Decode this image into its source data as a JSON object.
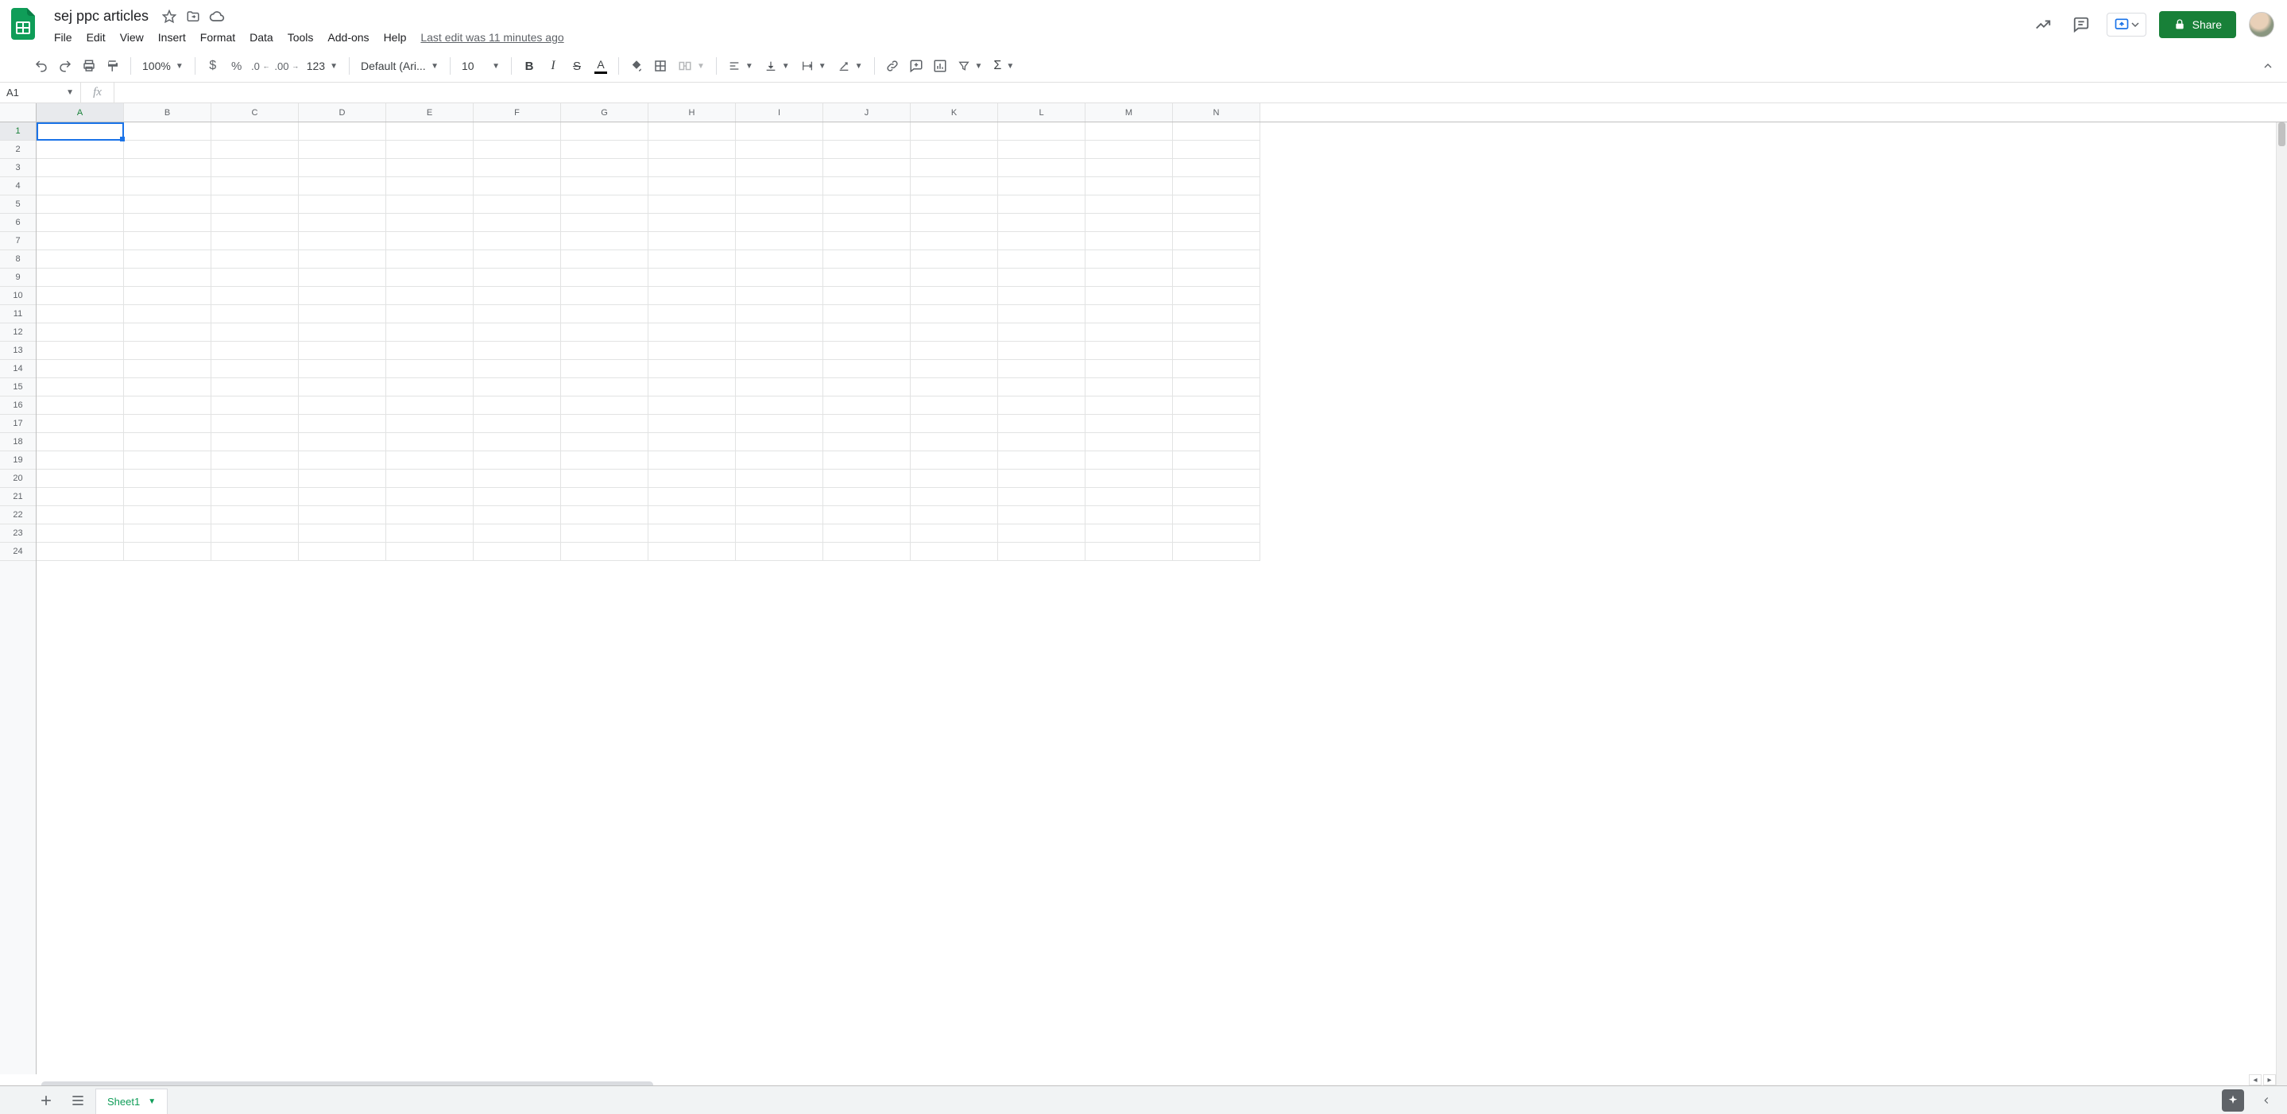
{
  "header": {
    "doc_title": "sej ppc articles",
    "last_edit": "Last edit was 11 minutes ago",
    "share_label": "Share",
    "menu": [
      "File",
      "Edit",
      "View",
      "Insert",
      "Format",
      "Data",
      "Tools",
      "Add-ons",
      "Help"
    ]
  },
  "toolbar": {
    "zoom": "100%",
    "font_name": "Default (Ari...",
    "font_size": "10",
    "num_format": "123"
  },
  "formula_bar": {
    "name_box": "A1",
    "fx_label": "fx",
    "formula_value": ""
  },
  "grid": {
    "columns": [
      "A",
      "B",
      "C",
      "D",
      "E",
      "F",
      "G",
      "H",
      "I",
      "J",
      "K",
      "L",
      "M",
      "N"
    ],
    "rows": [
      "1",
      "2",
      "3",
      "4",
      "5",
      "6",
      "7",
      "8",
      "9",
      "10",
      "11",
      "12",
      "13",
      "14",
      "15",
      "16",
      "17",
      "18",
      "19",
      "20",
      "21",
      "22",
      "23",
      "24"
    ],
    "active_cell": "A1"
  },
  "tabs": {
    "sheet_name": "Sheet1"
  }
}
